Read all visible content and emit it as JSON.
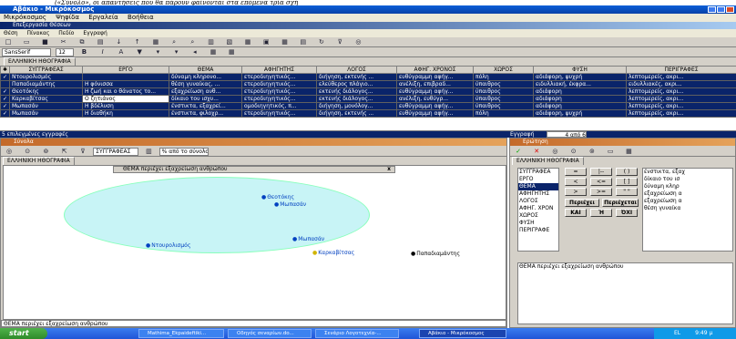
{
  "top_text": "(«Σύνολο», οι απαντήσεις που θα πάρουν φαίνονται στα επόμενα τρία σχή",
  "app": {
    "title": "Αβάκιο - Μικρόκοσμος",
    "menu": [
      "Μικρόκοσμος",
      "Ψηφίδα",
      "Εργαλεία",
      "Βοήθεια"
    ]
  },
  "browser": {
    "title": "Επεξεργασία Θέσεων",
    "menu": [
      "Θέση",
      "Πίνακας",
      "Πεδίο",
      "Εγγραφή"
    ],
    "font": "SansSerif",
    "size": "12",
    "tab": "ΕΛΛΗΝΙΚΗ ΗΘΟΓΡΑΦΙΑ",
    "columns": [
      "ΣΥΓΓΡΑΦΕΑΣ",
      "ΕΡΓΟ",
      "ΘΕΜΑ",
      "ΑΦΗΓΗΤΗΣ",
      "ΛΟΓΟΣ",
      "ΑΦΗΓ. ΧΡΟΝΟΣ",
      "ΧΩΡΟΣ",
      "ΦΥΣΗ",
      "ΠΕΡΙΓΡΑΦΕΣ"
    ],
    "rows": [
      {
        "selected": true,
        "cells": [
          "Ντουρολισμός",
          "",
          "δύναμη κληρονο...",
          "ετεροδιηγητικός...",
          "διήγηση, εκτενής ...",
          "ευθύγραμμη αφήγ...",
          "πόλη",
          "αδιάφορη, ψυχρή",
          "λεπτομερείς, ακρι..."
        ]
      },
      {
        "selected": false,
        "cells": [
          "Παπαδιαμάντης",
          "Η φόνισσα",
          "θέση γυναίκας, ...",
          "ετεροδιηγητικός...",
          "ελεύθερος πλάγιο...",
          "ανέλιξη, επιβραδ...",
          "ύπαιθρος",
          "ειδυλλιακή, έκφρα...",
          "ειδυλλιακές, ακρι..."
        ]
      },
      {
        "selected": true,
        "cells": [
          "Θεοτόκης",
          "Η ζωή και ο θάνατος το...",
          "εξαχρείωση ανθ...",
          "ετεροδιηγητικός...",
          "εκτενής διάλογος...",
          "ευθύγραμμη αφήγ...",
          "ύπαιθρος",
          "αδιάφορη",
          "λεπτομερείς, ακρι..."
        ]
      },
      {
        "selected": true,
        "cells": [
          "Καρκαβίτσας",
          "Ο ζητιάνος",
          "δίκαιο του ισχυ...",
          "ετεροδιηγητικός...",
          "εκτενής διάλογος...",
          "ανέλιξη, ευθύγρ...",
          "ύπαιθρος",
          "αδιάφορη",
          "λεπτομερείς, ακρι..."
        ]
      },
      {
        "selected": true,
        "cells": [
          "Μωπασάν",
          "Η βδέλυση",
          "ένστικτα, εξαχρεί...",
          "ομοδιηγητικός, π...",
          "διήγηση, μονόλογ...",
          "ευθύγραμμη αφήγ...",
          "ύπαιθρος",
          "αδιάφορη",
          "λεπτομερείς, ακρι..."
        ]
      },
      {
        "selected": true,
        "cells": [
          "Μωπασάν",
          "Η διαθήκη",
          "ένστικτα, φιλοχρ...",
          "ετεροδιηγητικός...",
          "διήγηση, εκτενής ...",
          "ευθύγραμμη αφήγ...",
          "πόλη",
          "αδιάφορη, ψυχρή",
          "λεπτομερείς, ακρι..."
        ]
      }
    ],
    "status_left": "5 επιλεγμένες εγγραφές",
    "status_record_label": "Εγγραφή",
    "status_record": "4 από 6"
  },
  "sets": {
    "title": "Σύνολα",
    "field": "ΣΥΓΓΡΑΦΕΑΣ",
    "percent": "% από το σύνολο",
    "tab": "ΕΛΛΗΝΙΚΗ ΗΘΟΓΡΑΦΙΑ",
    "set_label": "ΘΕΜΑ περιέχει εξαχρείωση ανθρώπου",
    "inside": [
      "Θεοτόκης",
      "Μωπασάν",
      "Μωπασάν",
      "Ντουρολισμός"
    ],
    "edge": "Καρκαβίτσας",
    "outside": "Παπαδιαμάντης",
    "close": "x",
    "footer": "ΘΕΜΑ περιέχει εξαχρείωση ανθρώπου"
  },
  "query": {
    "title": "Ερώτηση",
    "tab": "ΕΛΛΗΝΙΚΗ ΗΘΟΓΡΑΦΙΑ",
    "fields": [
      "ΣΥΓΓΡΑΦΕΑ",
      "ΕΡΓΟ",
      "ΘΕΜΑ",
      "ΑΦΗΓΗΤΗΣ",
      "ΛΟΓΟΣ",
      "ΑΦΗΓ. ΧΡΟΝ",
      "ΧΩΡΟΣ",
      "ΦΥΣΗ",
      "ΠΕΡΙΓΡΑΦΕ"
    ],
    "selected_field": "ΘΕΜΑ",
    "operators": [
      "=",
      "|--",
      "( )",
      "<",
      "<=",
      "[ ]",
      ">",
      ">=",
      "\" \""
    ],
    "contains": [
      "Περιέχει",
      "Περιέχεται"
    ],
    "logic": [
      "ΚΑΙ",
      "Ή",
      "ΌΧΙ"
    ],
    "values": [
      "ένστικτα, εξαχ",
      "δίκαιο του ισ",
      "δύναμη κληρ",
      "εξαχρείωση α",
      "εξαχρείωση α",
      "θέση γυναίκα"
    ],
    "expression": "ΘΕΜΑ περιέχει εξαχρείωση ανθρώπου"
  },
  "taskbar": {
    "start": "start",
    "tasks": [
      "Mathima_Ekpaideftiki...",
      "Οδηγός σεναρίων.do...",
      "Σενάριο Λογοτεχνία-...",
      "Αβάκιο - Μικρόκοσμος"
    ],
    "lang": "EL",
    "time": "9:49 μ"
  }
}
